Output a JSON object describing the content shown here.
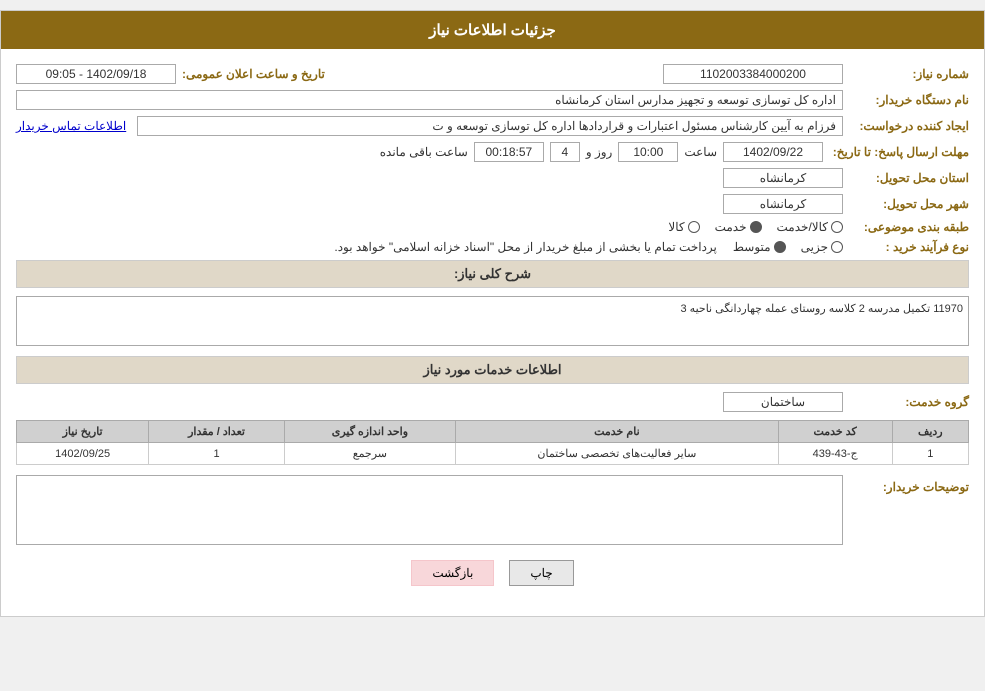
{
  "header": {
    "title": "جزئیات اطلاعات نیاز"
  },
  "fields": {
    "shomara_niaz_label": "شماره نیاز:",
    "shomara_niaz_value": "1102003384000200",
    "nam_dastgah_label": "نام دستگاه خریدار:",
    "nam_dastgah_value": "اداره کل توسازی  توسعه و تجهیز مدارس استان کرمانشاه",
    "ijad_konande_label": "ایجاد کننده درخواست:",
    "ijad_konande_value": "فرزام به آیین کارشناس مسئول اعتبارات و قراردادها اداره کل توسازی  توسعه و ت",
    "mohlat_label": "مهلت ارسال پاسخ: تا تاریخ:",
    "date_value": "1402/09/22",
    "saat_label": "ساعت",
    "saat_value": "10:00",
    "rooz_label": "روز و",
    "rooz_value": "4",
    "baqi_label": "ساعت باقی مانده",
    "baqi_value": "00:18:57",
    "ostan_label": "استان محل تحویل:",
    "ostan_value": "کرمانشاه",
    "shahr_label": "شهر محل تحویل:",
    "shahr_value": "کرمانشاه",
    "tabaqe_label": "طبقه بندی موضوعی:",
    "tabaqe_options": [
      "کالا",
      "خدمت",
      "کالا/خدمت"
    ],
    "tabaqe_selected": "خدمت",
    "nooe_farayand_label": "نوع فرآیند خرید :",
    "nooe_farayand_options": [
      "جزیی",
      "متوسط"
    ],
    "nooe_farayand_note": "پرداخت تمام یا بخشی از مبلغ خریدار از محل \"اسناد خزانه اسلامی\" خواهد بود.",
    "tarikh_sanat_label": "تاریخ و ساعت اعلان عمومی:",
    "tarikh_sanat_value": "1402/09/18 - 09:05",
    "etelaat_link": "اطلاعات تماس خریدار",
    "sharh_label": "شرح کلی نیاز:",
    "sharh_value": "11970 تکمیل مدرسه 2 کلاسه روستای عمله چهاردانگی ناحیه 3",
    "khadamat_title": "اطلاعات خدمات مورد نیاز",
    "goroh_label": "گروه خدمت:",
    "goroh_value": "ساختمان",
    "table_headers": [
      "ردیف",
      "کد خدمت",
      "نام خدمت",
      "واحد اندازه گیری",
      "تعداد / مقدار",
      "تاریخ نیاز"
    ],
    "table_rows": [
      {
        "radif": "1",
        "kod": "ج-43-439",
        "nam": "سایر فعالیت‌های تخصصی ساختمان",
        "vahed": "سرجمع",
        "tedad": "1",
        "tarikh": "1402/09/25"
      }
    ],
    "toseeh_label": "توضیحات خریدار:",
    "toseeh_value": "",
    "btn_chap": "چاپ",
    "btn_bazgasht": "بازگشت"
  }
}
